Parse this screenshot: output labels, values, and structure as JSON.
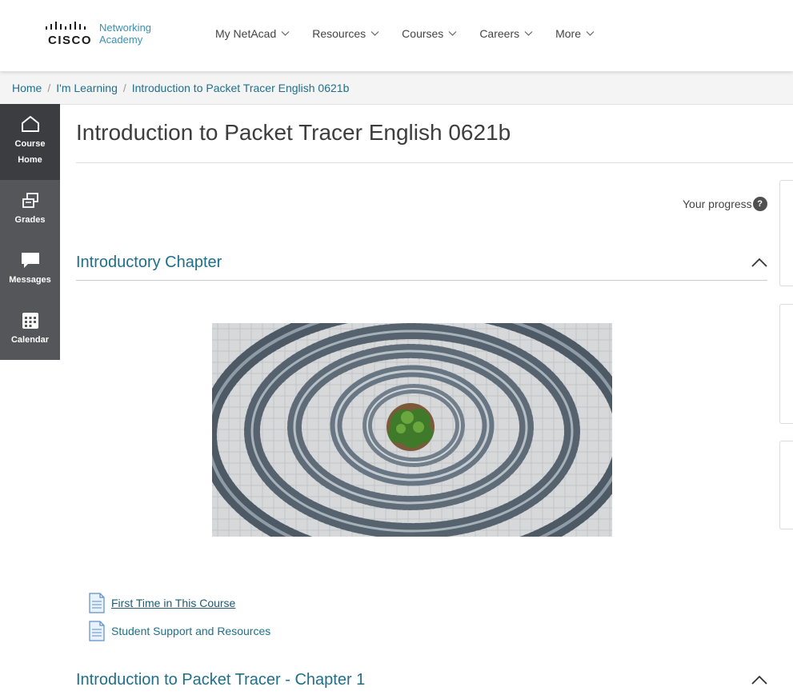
{
  "brand": {
    "wordmark": "CISCO",
    "line1": "Networking",
    "line2": "Academy"
  },
  "nav": [
    {
      "label": "My NetAcad",
      "icon": "chevron-down-icon"
    },
    {
      "label": "Resources",
      "icon": "chevron-down-icon"
    },
    {
      "label": "Courses",
      "icon": "chevron-down-icon"
    },
    {
      "label": "Careers",
      "icon": "chevron-down-icon"
    },
    {
      "label": "More",
      "icon": "chevron-down-icon"
    }
  ],
  "breadcrumb": {
    "separator": "/",
    "items": [
      "Home",
      "I'm Learning",
      "Introduction to Packet Tracer English 0621b"
    ]
  },
  "rail": [
    {
      "line1": "Course",
      "line2": "Home",
      "icon": "home-icon",
      "active": true
    },
    {
      "line1": "Grades",
      "icon": "grades-icon"
    },
    {
      "line1": "Messages",
      "icon": "messages-icon"
    },
    {
      "line1": "Calendar",
      "icon": "calendar-icon"
    }
  ],
  "page": {
    "title": "Introduction to Packet Tracer English 0621b",
    "progress_label": "Your progress",
    "help_glyph": "?"
  },
  "sections": [
    {
      "title": "Introductory Chapter",
      "expanded": true,
      "image_alt": "spiral staircase",
      "resources": [
        {
          "label": "First Time in This Course",
          "icon": "file-icon"
        },
        {
          "label": "Student Support and Resources",
          "icon": "file-icon"
        }
      ]
    },
    {
      "title": "Introduction to Packet Tracer - Chapter 1",
      "expanded": true
    }
  ],
  "colors": {
    "accent": "#1f6f8b",
    "rail": "#55565a",
    "rail_active": "#3c3d40",
    "brand_blue": "#3e8fb0"
  }
}
